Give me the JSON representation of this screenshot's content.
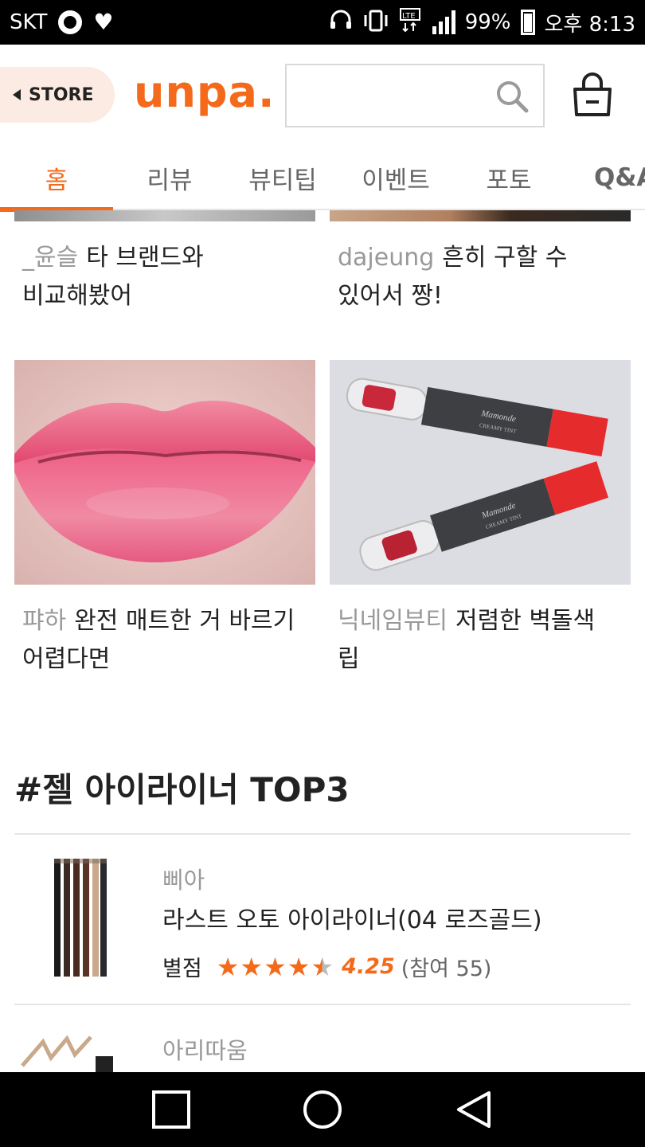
{
  "status_bar": {
    "carrier": "SKT",
    "network": "LTE",
    "battery": "99%",
    "time": "오후 8:13",
    "icons": [
      "ring-icon",
      "heart-icon",
      "headset-icon",
      "vibrate-icon",
      "lte-icon",
      "signal-icon",
      "battery-icon"
    ]
  },
  "header": {
    "store_label": "STORE",
    "logo": "unpa.",
    "search_placeholder": "",
    "accent_color": "#f46a1a"
  },
  "tabs": [
    {
      "label": "홈",
      "active": true
    },
    {
      "label": "리뷰",
      "active": false
    },
    {
      "label": "뷰티팁",
      "active": false
    },
    {
      "label": "이벤트",
      "active": false
    },
    {
      "label": "포토",
      "active": false
    },
    {
      "label": "Q&A",
      "active": false
    }
  ],
  "reviews": [
    {
      "user": "_윤슬",
      "text_line1": "타 브랜드와",
      "text_line2": "비교해봤어"
    },
    {
      "user": "dajeung",
      "text_line1": "흔히 구할 수",
      "text_line2": "있어서 짱!"
    },
    {
      "user": "퍄하",
      "text_line1": "완전 매트한 거 바르기",
      "text_line2": "어렵다면"
    },
    {
      "user": "닉네임뷰티",
      "text_line1": "저렴한 벽돌색",
      "text_line2": "립"
    }
  ],
  "section": {
    "title": "#젤 아이라이너 TOP3",
    "products": [
      {
        "brand": "삐아",
        "name": "라스트 오토 아이라이너(04 로즈골드)",
        "rating_label": "별점",
        "rating": "4.25",
        "participants": "(참여 55)"
      },
      {
        "brand": "아리따움"
      }
    ]
  }
}
